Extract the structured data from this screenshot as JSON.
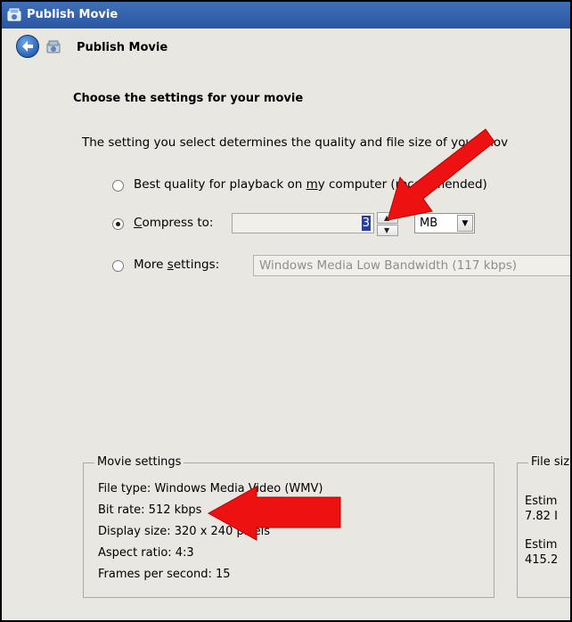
{
  "window": {
    "title": "Publish Movie"
  },
  "nav": {
    "title": "Publish Movie"
  },
  "page": {
    "heading": "Choose the settings for your movie",
    "description": "The setting you select determines the quality and file size of your mov"
  },
  "options": {
    "best_quality": {
      "label_before": "Best quality for playback on ",
      "label_mnemonic": "m",
      "label_after": "y computer (recommended)",
      "checked": false
    },
    "compress": {
      "label_mnemonic": "C",
      "label_after": "ompress to:",
      "checked": true,
      "value": "3",
      "unit": "MB"
    },
    "more": {
      "label_before": "More ",
      "label_mnemonic": "s",
      "label_after": "ettings:",
      "checked": false,
      "value": "Windows Media Low Bandwidth (117 kbps)"
    }
  },
  "movie_settings": {
    "legend": "Movie settings",
    "file_type": "File type: Windows Media Video (WMV)",
    "bit_rate": "Bit rate: 512 kbps",
    "display_size": "Display size: 320 x 240 pixels",
    "aspect_ratio": "Aspect ratio: 4:3",
    "fps": "Frames per second: 15"
  },
  "file_size": {
    "legend": "File siz",
    "estimated_label_1": "Estim",
    "estimated_value_1": "7.82 I",
    "estimated_label_2": "Estim",
    "estimated_value_2": "415.2"
  },
  "colors": {
    "titlebar": "#2a57a2",
    "panel": "#e9e7e2",
    "annotation_arrow": "#ee1111"
  },
  "icons": {
    "title": "movie-publish-icon",
    "back": "back-arrow-icon",
    "nav": "movie-publish-icon",
    "spin_up": "chevron-up-icon",
    "spin_down": "chevron-down-icon",
    "dropdown": "chevron-down-icon"
  }
}
